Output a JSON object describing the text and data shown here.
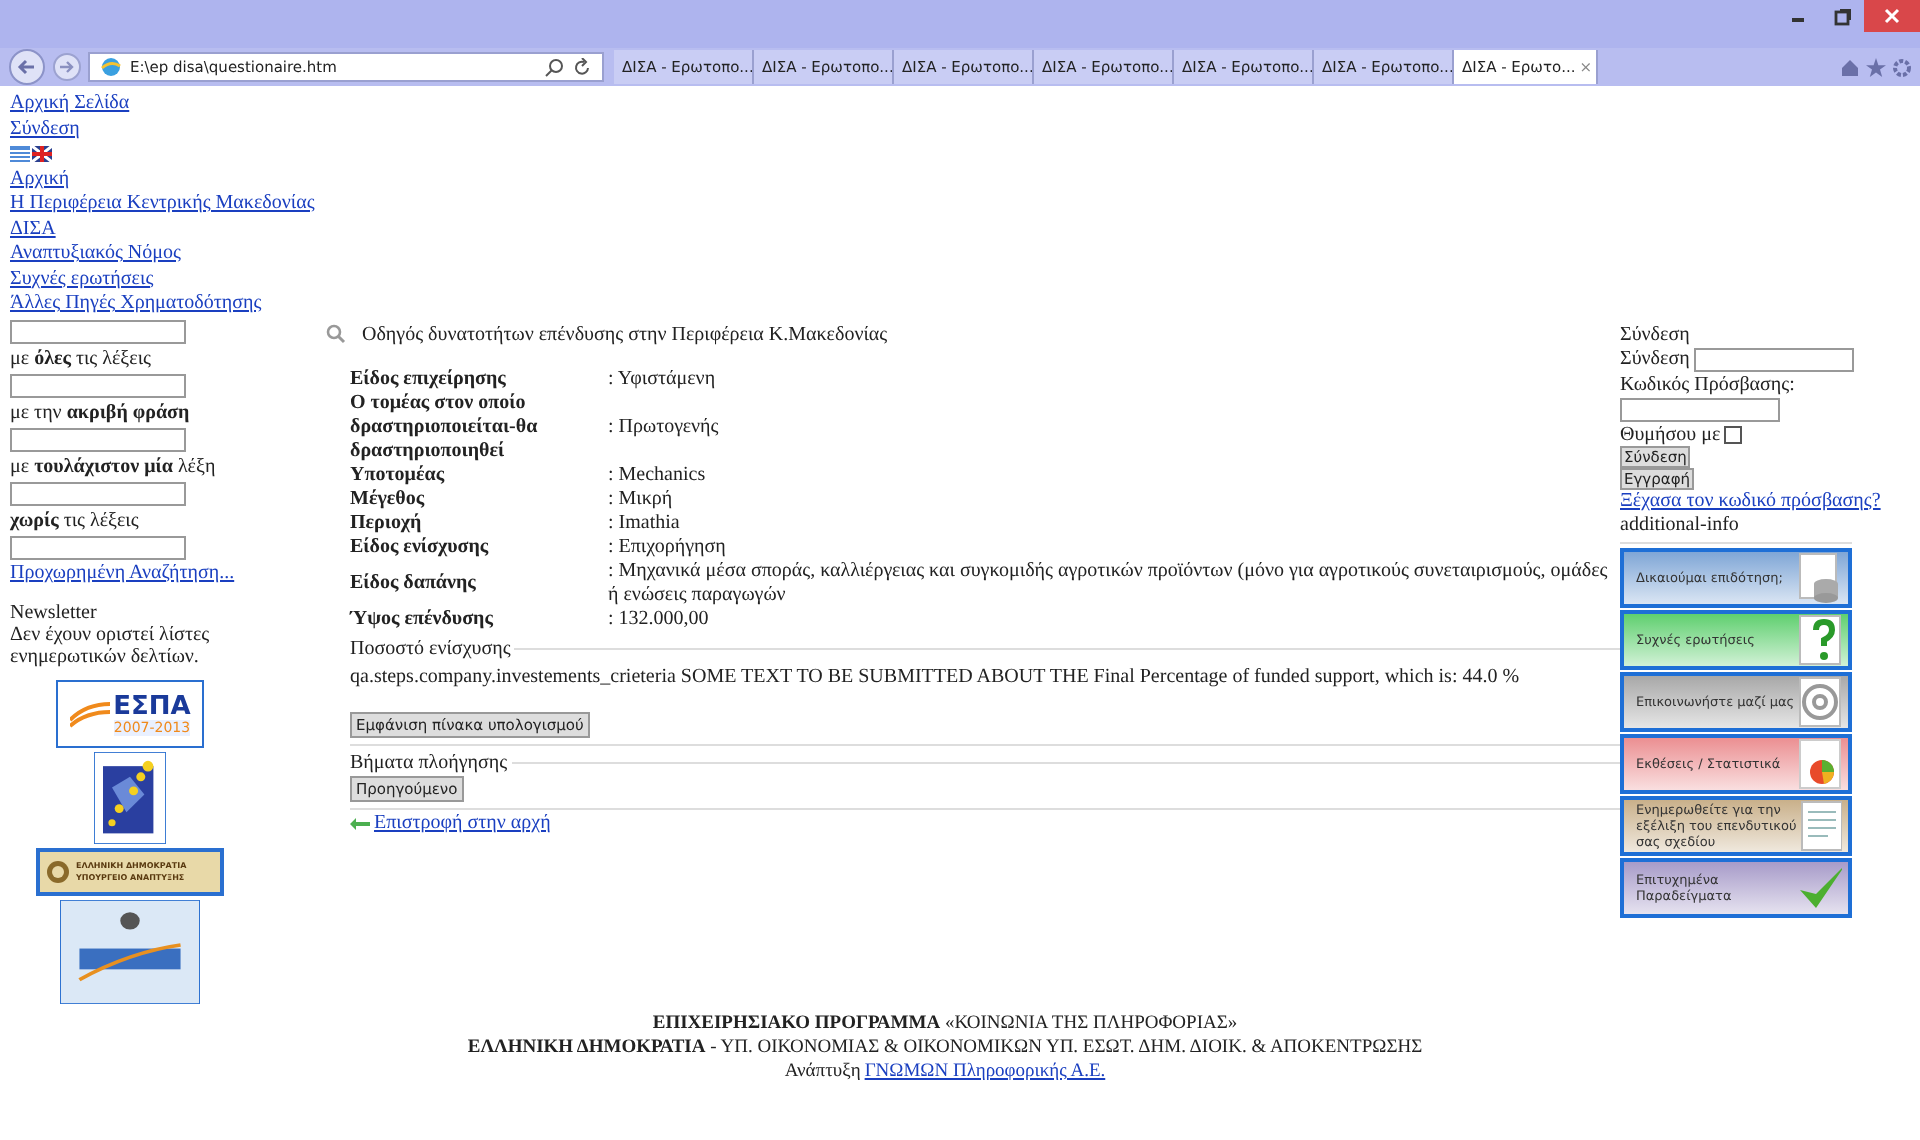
{
  "browser": {
    "address": "E:\\ep disa\\questionaire.htm",
    "tabs": [
      {
        "label": "ΔΙΣΑ - Ερωτοπο...",
        "selected": false
      },
      {
        "label": "ΔΙΣΑ - Ερωτοπο...",
        "selected": false
      },
      {
        "label": "ΔΙΣΑ - Ερωτοπο...",
        "selected": false
      },
      {
        "label": "ΔΙΣΑ - Ερωτοπο...",
        "selected": false
      },
      {
        "label": "ΔΙΣΑ - Ερωτοπο...",
        "selected": false
      },
      {
        "label": "ΔΙΣΑ - Ερωτοπο...",
        "selected": false
      },
      {
        "label": "ΔΙΣΑ - Ερωτο...",
        "selected": true
      }
    ],
    "close_tab": "×"
  },
  "top_links": [
    "Αρχική Σελίδα",
    "Σύνδεση"
  ],
  "nav_links": [
    "Αρχική",
    "Η Περιφέρεια Κεντρικής Μακεδονίας",
    "ΔΙΣΑ",
    "Αναπτυξιακός Νόμος",
    "Συχνές ερωτήσεις",
    "Άλλες Πηγές Χρηματοδότησης"
  ],
  "search": {
    "fields": [
      {
        "label": "με **όλες** τις λέξεις"
      },
      {
        "label": "με την **ακριβή φράση**"
      },
      {
        "label": "με **τουλάχιστον μία** λέξη"
      },
      {
        "label": "**χωρίς** τις λέξεις"
      }
    ],
    "advanced_link": "Προχωρημένη Αναζήτηση..."
  },
  "newsletter": {
    "title": "Newsletter",
    "text": "Δεν έχουν οριστεί λίστες ενημερωτικών δελτίων."
  },
  "logos": {
    "espa": {
      "name": "ΕΣΠΑ",
      "years": "2007-2013"
    },
    "ministry": {
      "line1": "ΕΛΛΗΝΙΚΗ ΔΗΜΟΚΡΑΤΙΑ",
      "line2": "ΥΠΟΥΡΓΕΙΟ ΑΝΑΠΤΥΞΗΣ"
    }
  },
  "main": {
    "title": "Οδηγός δυνατοτήτων επένδυσης στην Περιφέρεια Κ.Μακεδονίας",
    "details": [
      {
        "label": "Είδος επιχείρησης",
        "value": ": Υφιστάμενη"
      },
      {
        "label": "Ο τομέας στον οποίο δραστηριοποιείται-θα δραστηριοποιηθεί",
        "value": ": Πρωτογενής"
      },
      {
        "label": "Υποτομέας",
        "value": ": Mechanics"
      },
      {
        "label": "Μέγεθος",
        "value": ": Μικρή"
      },
      {
        "label": "Περιοχή",
        "value": ": Imathia"
      },
      {
        "label": "Είδος ενίσχυσης",
        "value": ": Επιχορήγηση"
      },
      {
        "label": "Είδος δαπάνης",
        "value": ": Μηχανικά μέσα σποράς, καλλιέργειας και συγκομιδής αγροτικών προϊόντων (μόνο για αγροτικούς συνεταιρισμούς, ομάδες ή ενώσεις παραγωγών"
      },
      {
        "label": "Ύψος επένδυσης",
        "value": ": 132.000,00"
      }
    ],
    "percentage": {
      "legend": "Ποσοστό ενίσχυσης",
      "text": "qa.steps.company.investements_crieteria SOME TEXT TO BE SUBMITTED ABOUT THE Final Percentage of funded support, which is: 44.0 %",
      "button": "Εμφάνιση πίνακα υπολογισμού"
    },
    "navigation": {
      "legend": "Βήματα πλοήγησης",
      "button": "Προηγούμενο"
    },
    "back_link": "Επιστροφή στην αρχή"
  },
  "login": {
    "title": "Σύνδεση",
    "username_label": "Σύνδεση",
    "password_label": "Κωδικός Πρόσβασης:",
    "remember_label": "Θυμήσου με",
    "remember_checked": false,
    "login_button": "Σύνδεση",
    "register_button": "Εγγραφή",
    "forgot_link": "Ξέχασα τον κωδικό πρόσβασης?",
    "extra": "additional-info"
  },
  "side_buttons": [
    {
      "label": "Δικαιούμαι επιδότηση;",
      "kind": "database",
      "color": "#7fa6d6"
    },
    {
      "label": "Συχνές ερωτήσεις",
      "kind": "question",
      "color": "#5fcf6f"
    },
    {
      "label": "Επικοινωνήστε μαζί μας",
      "kind": "at",
      "color": "#a8a8a8"
    },
    {
      "label": "Εκθέσεις / Στατιστικά",
      "kind": "chart",
      "color": "#eb8f92"
    },
    {
      "label": "Ενημερωθείτε για την εξέλιξη του επενδυτικού σας σχεδίου",
      "kind": "document",
      "color": "#c9b08a"
    },
    {
      "label": "Επιτυχημένα Παραδείγματα",
      "kind": "check",
      "color": "#a79bc9"
    }
  ],
  "footer": {
    "line1": "**ΕΠΙΧΕΙΡΗΣΙΑΚΟ ΠΡΟΓΡΑΜΜΑ** «ΚΟΙΝΩΝΙΑ ΤΗΣ ΠΛΗΡΟΦΟΡΙΑΣ»",
    "line2": "**ΕΛΛΗΝΙΚΗ ΔΗΜΟΚΡΑΤΙΑ** - ΥΠ. ΟΙΚΟΝΟΜΙΑΣ & ΟΙΚΟΝΟΜΙΚΩΝ ΥΠ. ΕΣΩΤ. ΔΗΜ. ΔΙΟΙΚ. & ΑΠΟΚΕΝΤΡΩΣΗΣ",
    "credit": "Ανάπτυξη",
    "credit_link": "ΓΝΩΜΩΝ Πληροφορικής Α.Ε."
  }
}
